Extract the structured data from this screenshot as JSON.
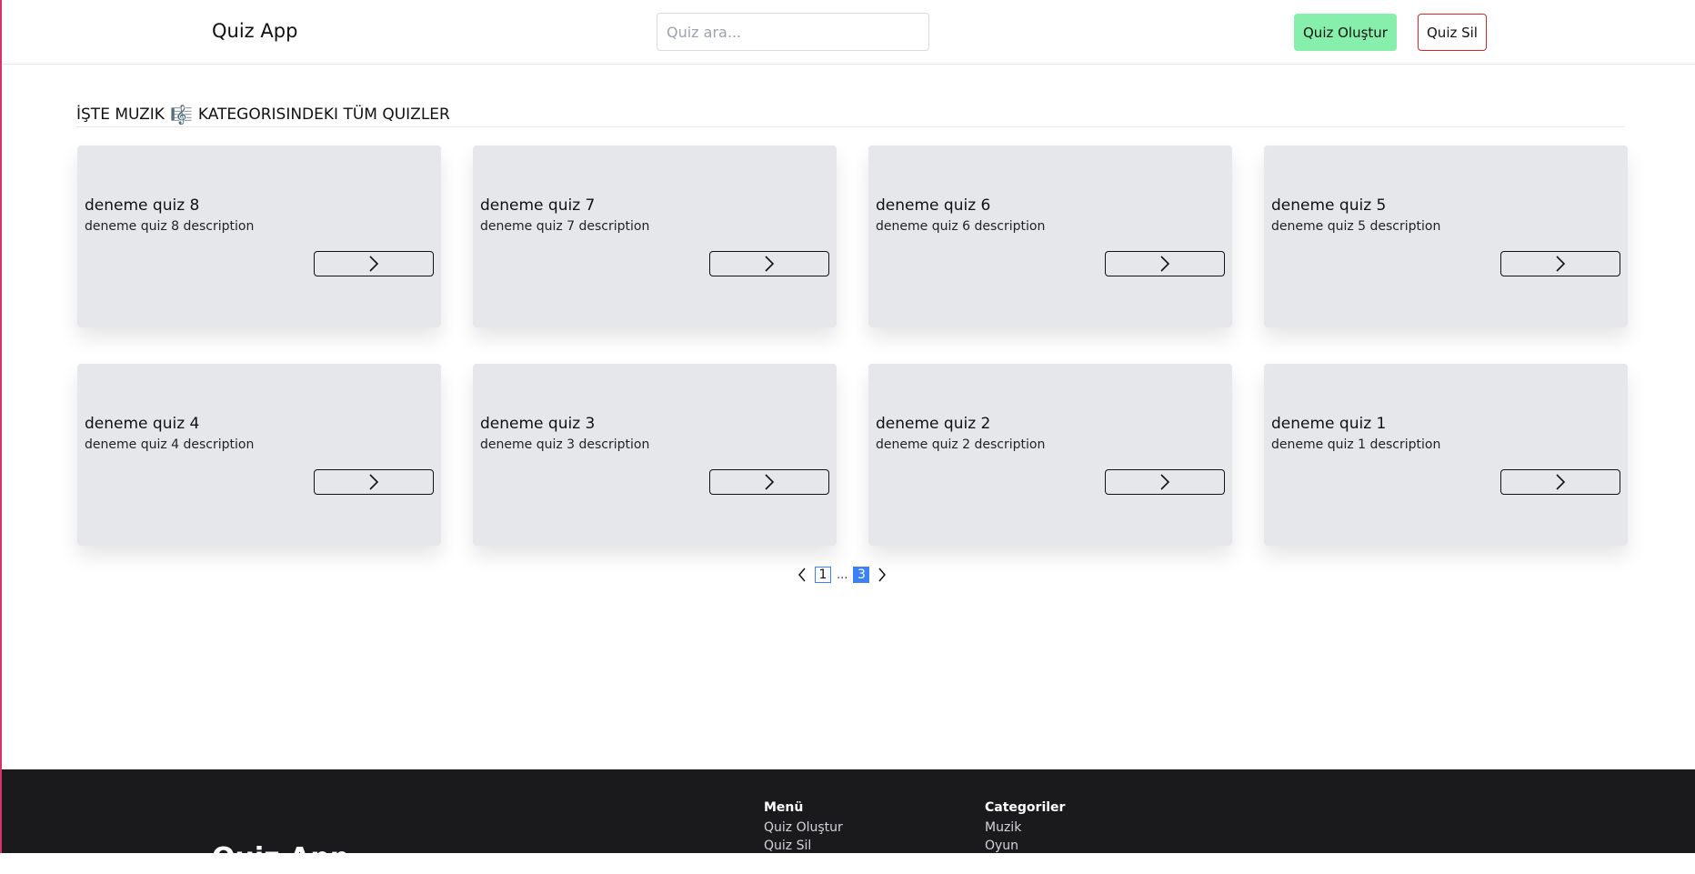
{
  "header": {
    "logo": "Quiz App",
    "search_placeholder": "Quiz ara...",
    "create_button": "Quiz Oluştur",
    "delete_button": "Quiz Sil"
  },
  "section": {
    "title_prefix": "İŞTE MUZIK",
    "title_emoji": "🎼",
    "title_suffix": "KATEGORISINDEKI TÜM QUIZLER"
  },
  "quizzes": [
    {
      "title": "deneme quiz 8",
      "description": "deneme quiz 8 description"
    },
    {
      "title": "deneme quiz 7",
      "description": "deneme quiz 7 description"
    },
    {
      "title": "deneme quiz 6",
      "description": "deneme quiz 6 description"
    },
    {
      "title": "deneme quiz 5",
      "description": "deneme quiz 5 description"
    },
    {
      "title": "deneme quiz 4",
      "description": "deneme quiz 4 description"
    },
    {
      "title": "deneme quiz 3",
      "description": "deneme quiz 3 description"
    },
    {
      "title": "deneme quiz 2",
      "description": "deneme quiz 2 description"
    },
    {
      "title": "deneme quiz 1",
      "description": "deneme quiz 1 description"
    }
  ],
  "pagination": {
    "first_page": "1",
    "ellipsis": "...",
    "current_page": "3"
  },
  "footer": {
    "logo": "Quiz App",
    "menu_heading": "Menü",
    "menu_links": [
      "Quiz Oluştur",
      "Quiz Sil"
    ],
    "categories_heading": "Categoriler",
    "category_links": [
      "Muzik",
      "Oyun"
    ]
  },
  "colors": {
    "accent": "#3b82f6",
    "create_button_bg": "#86efac",
    "delete_button_border": "#dc2626",
    "card_bg": "#e5e7eb",
    "footer_bg": "#1a1a1c"
  }
}
